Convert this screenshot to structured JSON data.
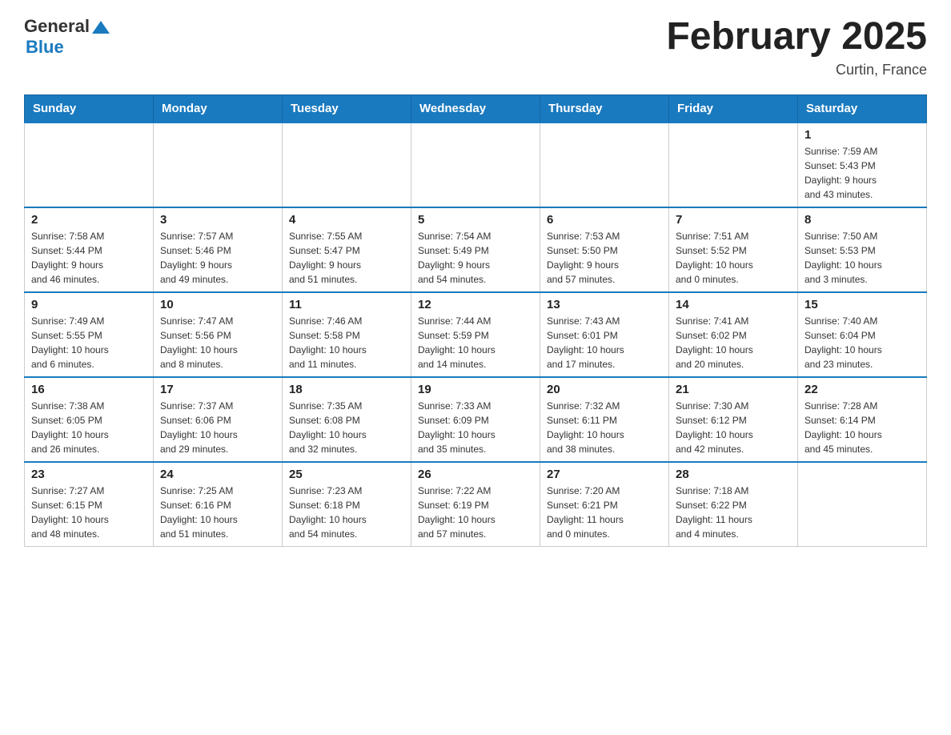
{
  "header": {
    "logo_general": "General",
    "logo_blue": "Blue",
    "month_title": "February 2025",
    "location": "Curtin, France"
  },
  "days_of_week": [
    "Sunday",
    "Monday",
    "Tuesday",
    "Wednesday",
    "Thursday",
    "Friday",
    "Saturday"
  ],
  "weeks": [
    {
      "days": [
        {
          "number": "",
          "info": ""
        },
        {
          "number": "",
          "info": ""
        },
        {
          "number": "",
          "info": ""
        },
        {
          "number": "",
          "info": ""
        },
        {
          "number": "",
          "info": ""
        },
        {
          "number": "",
          "info": ""
        },
        {
          "number": "1",
          "info": "Sunrise: 7:59 AM\nSunset: 5:43 PM\nDaylight: 9 hours\nand 43 minutes."
        }
      ]
    },
    {
      "days": [
        {
          "number": "2",
          "info": "Sunrise: 7:58 AM\nSunset: 5:44 PM\nDaylight: 9 hours\nand 46 minutes."
        },
        {
          "number": "3",
          "info": "Sunrise: 7:57 AM\nSunset: 5:46 PM\nDaylight: 9 hours\nand 49 minutes."
        },
        {
          "number": "4",
          "info": "Sunrise: 7:55 AM\nSunset: 5:47 PM\nDaylight: 9 hours\nand 51 minutes."
        },
        {
          "number": "5",
          "info": "Sunrise: 7:54 AM\nSunset: 5:49 PM\nDaylight: 9 hours\nand 54 minutes."
        },
        {
          "number": "6",
          "info": "Sunrise: 7:53 AM\nSunset: 5:50 PM\nDaylight: 9 hours\nand 57 minutes."
        },
        {
          "number": "7",
          "info": "Sunrise: 7:51 AM\nSunset: 5:52 PM\nDaylight: 10 hours\nand 0 minutes."
        },
        {
          "number": "8",
          "info": "Sunrise: 7:50 AM\nSunset: 5:53 PM\nDaylight: 10 hours\nand 3 minutes."
        }
      ]
    },
    {
      "days": [
        {
          "number": "9",
          "info": "Sunrise: 7:49 AM\nSunset: 5:55 PM\nDaylight: 10 hours\nand 6 minutes."
        },
        {
          "number": "10",
          "info": "Sunrise: 7:47 AM\nSunset: 5:56 PM\nDaylight: 10 hours\nand 8 minutes."
        },
        {
          "number": "11",
          "info": "Sunrise: 7:46 AM\nSunset: 5:58 PM\nDaylight: 10 hours\nand 11 minutes."
        },
        {
          "number": "12",
          "info": "Sunrise: 7:44 AM\nSunset: 5:59 PM\nDaylight: 10 hours\nand 14 minutes."
        },
        {
          "number": "13",
          "info": "Sunrise: 7:43 AM\nSunset: 6:01 PM\nDaylight: 10 hours\nand 17 minutes."
        },
        {
          "number": "14",
          "info": "Sunrise: 7:41 AM\nSunset: 6:02 PM\nDaylight: 10 hours\nand 20 minutes."
        },
        {
          "number": "15",
          "info": "Sunrise: 7:40 AM\nSunset: 6:04 PM\nDaylight: 10 hours\nand 23 minutes."
        }
      ]
    },
    {
      "days": [
        {
          "number": "16",
          "info": "Sunrise: 7:38 AM\nSunset: 6:05 PM\nDaylight: 10 hours\nand 26 minutes."
        },
        {
          "number": "17",
          "info": "Sunrise: 7:37 AM\nSunset: 6:06 PM\nDaylight: 10 hours\nand 29 minutes."
        },
        {
          "number": "18",
          "info": "Sunrise: 7:35 AM\nSunset: 6:08 PM\nDaylight: 10 hours\nand 32 minutes."
        },
        {
          "number": "19",
          "info": "Sunrise: 7:33 AM\nSunset: 6:09 PM\nDaylight: 10 hours\nand 35 minutes."
        },
        {
          "number": "20",
          "info": "Sunrise: 7:32 AM\nSunset: 6:11 PM\nDaylight: 10 hours\nand 38 minutes."
        },
        {
          "number": "21",
          "info": "Sunrise: 7:30 AM\nSunset: 6:12 PM\nDaylight: 10 hours\nand 42 minutes."
        },
        {
          "number": "22",
          "info": "Sunrise: 7:28 AM\nSunset: 6:14 PM\nDaylight: 10 hours\nand 45 minutes."
        }
      ]
    },
    {
      "days": [
        {
          "number": "23",
          "info": "Sunrise: 7:27 AM\nSunset: 6:15 PM\nDaylight: 10 hours\nand 48 minutes."
        },
        {
          "number": "24",
          "info": "Sunrise: 7:25 AM\nSunset: 6:16 PM\nDaylight: 10 hours\nand 51 minutes."
        },
        {
          "number": "25",
          "info": "Sunrise: 7:23 AM\nSunset: 6:18 PM\nDaylight: 10 hours\nand 54 minutes."
        },
        {
          "number": "26",
          "info": "Sunrise: 7:22 AM\nSunset: 6:19 PM\nDaylight: 10 hours\nand 57 minutes."
        },
        {
          "number": "27",
          "info": "Sunrise: 7:20 AM\nSunset: 6:21 PM\nDaylight: 11 hours\nand 0 minutes."
        },
        {
          "number": "28",
          "info": "Sunrise: 7:18 AM\nSunset: 6:22 PM\nDaylight: 11 hours\nand 4 minutes."
        },
        {
          "number": "",
          "info": ""
        }
      ]
    }
  ]
}
